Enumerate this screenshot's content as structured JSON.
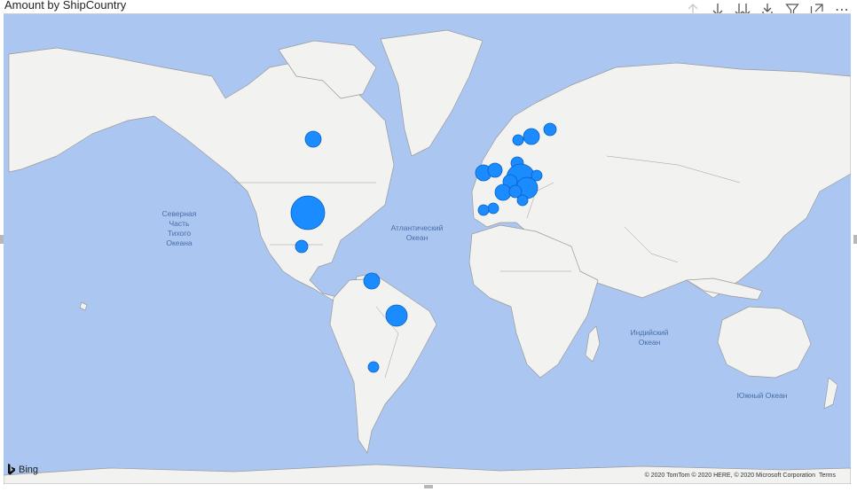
{
  "visual": {
    "title": "Amount by ShipCountry",
    "header_icons": [
      "drill-up-icon",
      "drill-down-icon",
      "expand-all-icon",
      "expand-next-level-icon",
      "filter-icon",
      "focus-mode-icon",
      "more-options-icon"
    ],
    "more_options_glyph": "⋯"
  },
  "map": {
    "ocean_color": "#abc6f0",
    "land_color": "#f2f2f0",
    "border_color": "#9a9a9a",
    "bubble_color": "#1a8cff",
    "bubble_stroke": "#0a5fc2",
    "labels": {
      "pacific": [
        "Северная",
        "Часть",
        "Тихого",
        "Океана"
      ],
      "atlantic": [
        "Атлантический",
        "Океан"
      ],
      "indian": [
        "Индийский",
        "Океан"
      ],
      "southern": [
        "Южный Океан"
      ]
    }
  },
  "footer": {
    "bing": "Bing",
    "copyright": "© 2020 TomTom © 2020 HERE, © 2020 Microsoft Corporation",
    "terms": "Terms"
  }
}
